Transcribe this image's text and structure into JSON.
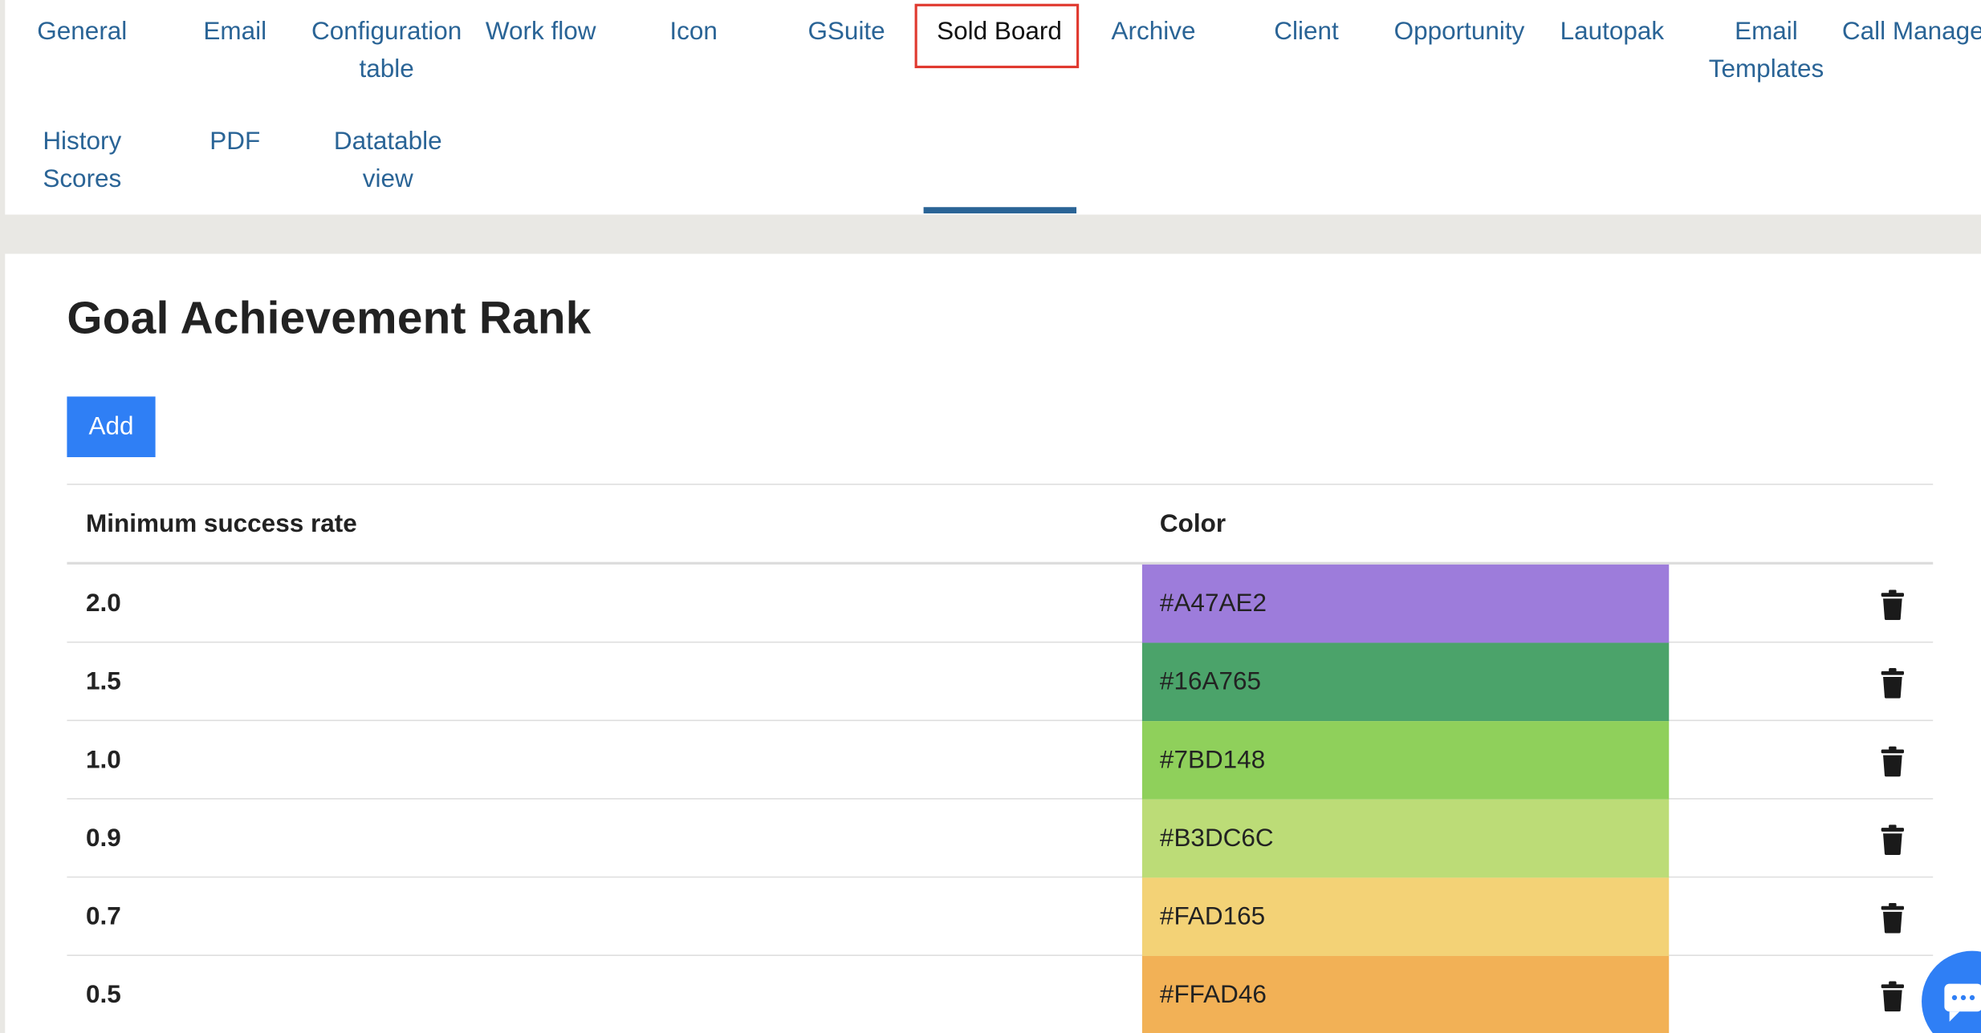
{
  "tabs": [
    {
      "label": "General"
    },
    {
      "label": "Email"
    },
    {
      "label": "Configuration table"
    },
    {
      "label": "Work flow"
    },
    {
      "label": "Icon"
    },
    {
      "label": "GSuite"
    },
    {
      "label": "Sold Board",
      "active": true
    },
    {
      "label": "Archive"
    },
    {
      "label": "Client"
    },
    {
      "label": "Opportunity"
    },
    {
      "label": "Lautopak"
    },
    {
      "label": "Email Templates"
    },
    {
      "label": "Call Manage"
    },
    {
      "label": "History Scores"
    },
    {
      "label": "PDF"
    },
    {
      "label": "Datatable view"
    }
  ],
  "page": {
    "title": "Goal Achievement Rank",
    "add_label": "Add"
  },
  "table": {
    "headers": {
      "rate": "Minimum success rate",
      "color": "Color"
    },
    "rows": [
      {
        "rate": "2.0",
        "color_label": "#A47AE2",
        "fill": "#9d7cdb"
      },
      {
        "rate": "1.5",
        "color_label": "#16A765",
        "fill": "#4ba36a"
      },
      {
        "rate": "1.0",
        "color_label": "#7BD148",
        "fill": "#8fd05b"
      },
      {
        "rate": "0.9",
        "color_label": "#B3DC6C",
        "fill": "#bcdc77"
      },
      {
        "rate": "0.7",
        "color_label": "#FAD165",
        "fill": "#f3d276"
      },
      {
        "rate": "0.5",
        "color_label": "#FFAD46",
        "fill": "#f2b156"
      }
    ]
  },
  "icons": {
    "delete": "trash-icon",
    "chat": "chat-bubble-icon"
  },
  "colors": {
    "link": "#2a6496",
    "active_tab_outline": "#e0392f",
    "primary_button": "#2f7ff5",
    "page_background": "#e9e8e4"
  }
}
